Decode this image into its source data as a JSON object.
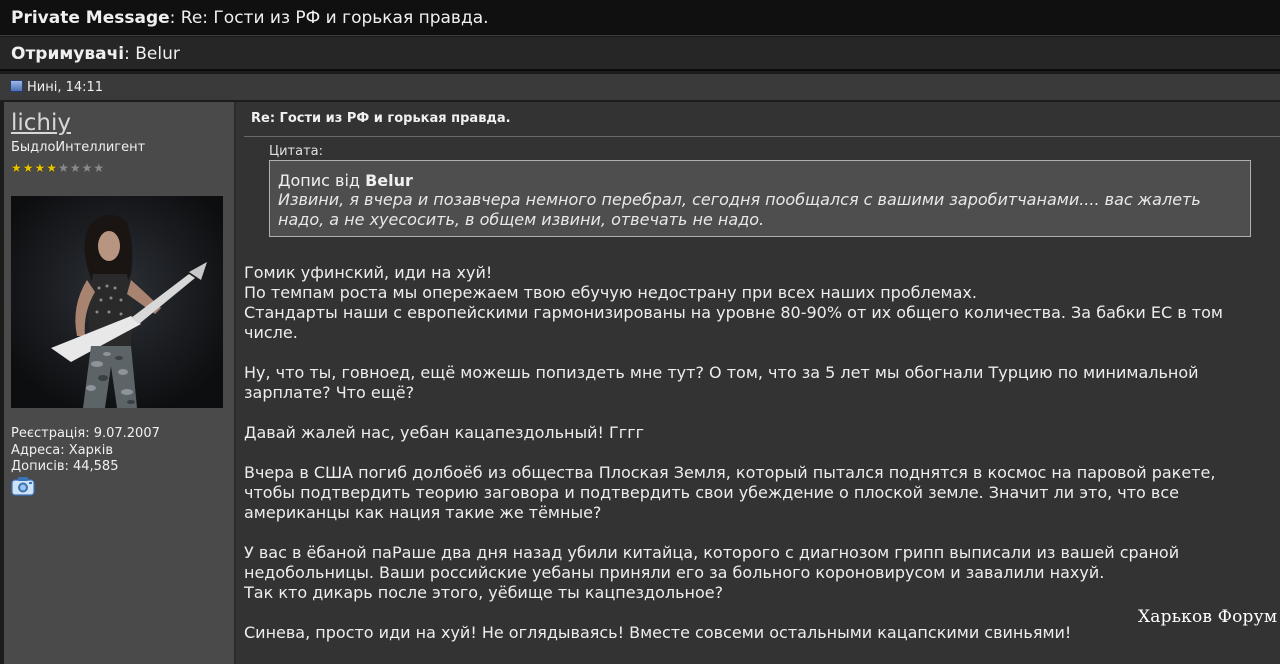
{
  "header": {
    "label": "Private Message",
    "separator": ": ",
    "subject": "Re: Гости из РФ и горькая правда."
  },
  "recipients": {
    "label": "Отримувачі",
    "separator": ": ",
    "value": "Belur"
  },
  "post_meta": {
    "date": "Нині, 14:11"
  },
  "user": {
    "name": "lichiy",
    "title": "БыдлоИнтеллигент",
    "rating": {
      "filled": 4,
      "total": 8
    },
    "registration": "Реєстрація: 9.07.2007",
    "address": "Адреса: Харків",
    "posts": "Дописів: 44,585"
  },
  "message": {
    "title": "Re: Гости из РФ и горькая правда.",
    "quote": {
      "label": "Цитата:",
      "by_prefix": "Допис від ",
      "author": "Belur",
      "text_line1": "Извини, я вчера и позавчера немного перебрал, сегодня пообщался с вашими заробитчанами.... вас жалеть",
      "text_line2": "надо, а не хуесосить, в общем извини, отвечать не надо."
    },
    "paragraphs": [
      [
        "Гомик уфинский, иди на хуй!",
        "По темпам роста мы опережаем твою ебучую недострану при всех наших проблемах.",
        "Стандарты наши с европейскими гармонизированы на уровне 80-90% от их общего количества. За бабки ЕС в том",
        "числе."
      ],
      [
        "Ну, что ты, говноед, ещё можешь попиздеть мне тут? О том, что за 5 лет мы обогнали Турцию по минимальной",
        "зарплате? Что ещё?"
      ],
      [
        "Давай жалей нас, уебан кацапездольный! Гггг"
      ],
      [
        "Вчера в США погиб долбоёб из общества Плоская Земля, который пытался поднятся в космос на паровой ракете,",
        "чтобы подтвердить теорию заговора и подтвердить свои убеждение о плоской земле. Значит ли это, что все",
        "американцы как нация такие же тёмные?"
      ],
      [
        "У вас в ёбаной паРаше два дня назад убили китайца, которого с диагнозом грипп выписали из вашей сраной",
        "недобольницы. Ваши российские уебаны приняли его за больного короновирусом и завалили нахуй.",
        "Так кто дикарь после этого, уёбище ты кацпездольное?"
      ],
      [
        "Синева, просто иди на хуй! Не оглядываясь! Вместе совсеми остальными кацапскими свиньями!"
      ]
    ]
  },
  "watermark": "Харьков Форум",
  "icons": {
    "post": "post-icon",
    "camera": "camera-icon"
  },
  "colors": {
    "left_panel": "#4a4a4a",
    "right_panel": "#333333",
    "quote_bg": "#4e4e4e",
    "star_on": "#e8c300"
  }
}
